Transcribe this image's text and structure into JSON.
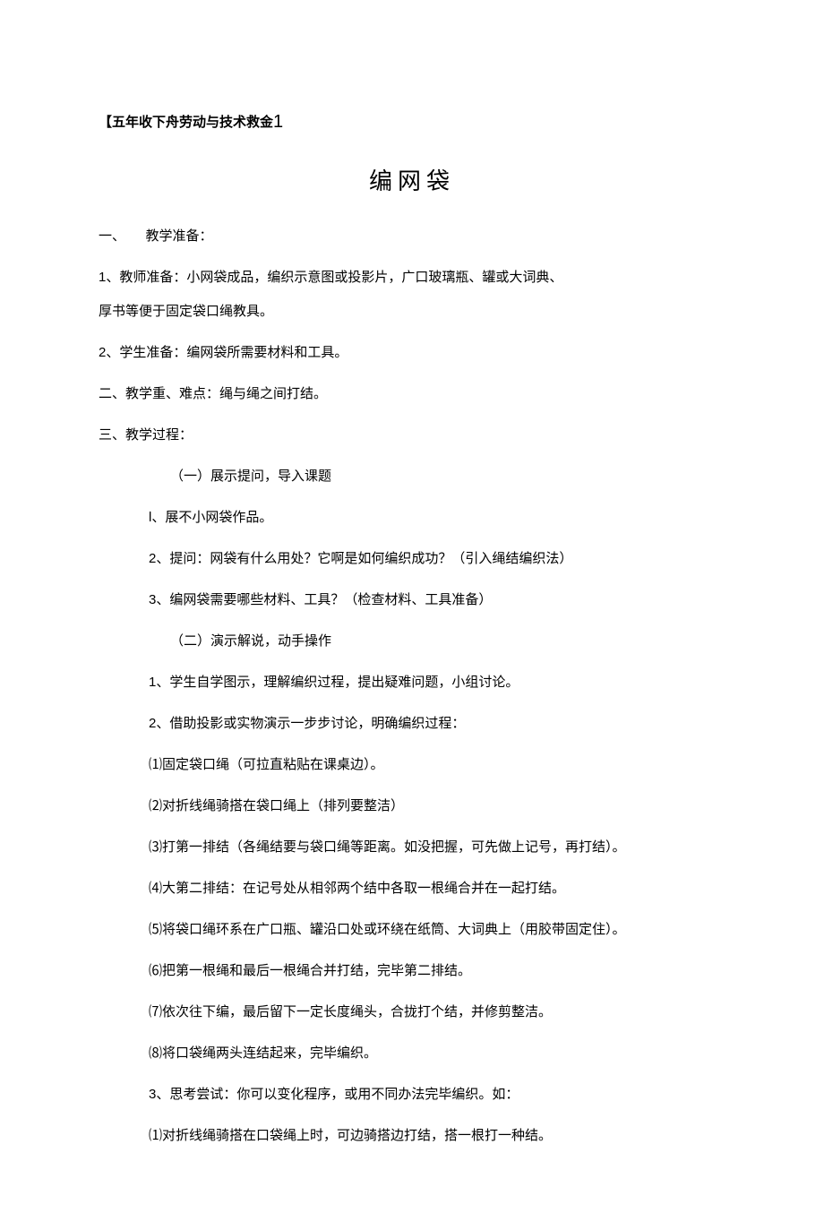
{
  "header": {
    "prefix": "【五年收下舟劳动与技术救金",
    "num": "1"
  },
  "title": "编网袋",
  "s1": {
    "h": "一、　　教学准备：",
    "p1a": "1",
    "p1b": "、教师准备：小网袋成品，编织示意图或投影片，广口玻璃瓶、罐或大词典、",
    "p1c": "厚书等便于固定袋口绳教具。",
    "p2a": "2",
    "p2b": "、学生准备：编网袋所需要材料和工具。"
  },
  "s2": "二、教学重、难点：绳与绳之间打结。",
  "s3": {
    "h": "三、教学过程：",
    "sub1": "（一）展示提问，导入课题",
    "l1a": "l",
    "l1b": "、展不小网袋作品。",
    "l2a": "2",
    "l2b": "、提问：网袋有什么用处？它啊是如何编织成功？（引入绳结编织法）",
    "l3a": "3",
    "l3b": "、编网袋需要哪些材料、工具？（检查材料、工具准备）",
    "sub2": "（二）演示解说，动手操作",
    "m1a": "1",
    "m1b": "、学生自学图示，理解编织过程，提出疑难问题，小组讨论。",
    "m2a": "2",
    "m2b": "、借助投影或实物演示一步步讨论，明确编织过程：",
    "step1": "⑴固定袋口绳（可拉直粘贴在课桌边）。",
    "step2": "⑵对折线绳骑搭在袋口绳上（排列要整洁）",
    "step3": "⑶打第一排结（各绳结要与袋口绳等距离。如没把握，可先做上记号，再打结）。",
    "step4": "⑷大第二排结：在记号处从相邻两个结中各取一根绳合并在一起打结。",
    "step5": "⑸将袋口绳环系在广口瓶、罐沿口处或环绕在纸筒、大词典上（用胶带固定住）。",
    "step6": "⑹把第一根绳和最后一根绳合并打结，完毕第二排结。",
    "step7": "⑺依次往下编，最后留下一定长度绳头，合拢打个结，并修剪整洁。",
    "step8": "⑻将口袋绳两头连结起来，完毕编织。",
    "m3a": "3",
    "m3b": "、思考尝试：你可以变化程序，或用不同办法完毕编织。如：",
    "v1": "⑴对折线绳骑搭在口袋绳上时，可边骑搭边打结，搭一根打一种结。"
  }
}
